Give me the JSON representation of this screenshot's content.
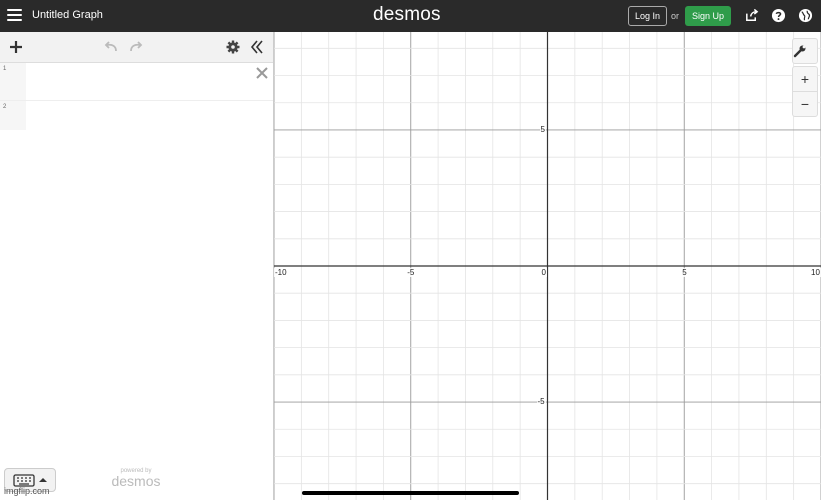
{
  "header": {
    "menu_icon": "hamburger-menu-icon",
    "graph_title": "Untitled Graph",
    "logo": "desmos",
    "login_label": "Log In",
    "or_text": "or",
    "signup_label": "Sign Up",
    "signup_color": "#2f9c4a",
    "share_icon": "share-icon",
    "help_icon": "help-icon",
    "language_icon": "globe-icon"
  },
  "toolbar": {
    "add_icon": "plus-icon",
    "undo_icon": "undo-icon",
    "redo_icon": "redo-icon",
    "settings_icon": "gear-icon",
    "collapse_icon": "double-chevron-left-icon"
  },
  "expressions": [
    {
      "number": "1",
      "value": "",
      "has_delete": true
    },
    {
      "number": "2",
      "value": "",
      "has_delete": false
    }
  ],
  "footer": {
    "keyboard_icon": "keyboard-icon",
    "powered_by": "powered by",
    "powered_logo": "desmos",
    "watermark": "imgflip.com"
  },
  "graph": {
    "x_range": [
      -10,
      10
    ],
    "y_range": [
      -8.6,
      8.6
    ],
    "major_step": 5,
    "minor_step": 1,
    "grid": true,
    "x_tick_labels": [
      "-10",
      "-5",
      "0",
      "5",
      "10"
    ],
    "y_tick_labels": [
      "5",
      "-5"
    ],
    "settings_icon": "wrench-icon",
    "zoom_in_label": "+",
    "zoom_out_label": "−"
  }
}
